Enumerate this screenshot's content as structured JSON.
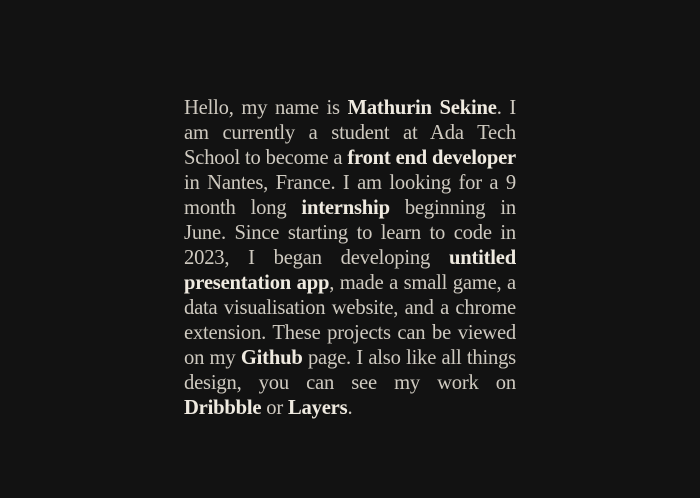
{
  "bio": {
    "p1": "Hello, my name is ",
    "name": "Mathurin Sekine",
    "p2": ". I am currently a student at Ada Tech School to become a ",
    "role": "front end developer",
    "p3": " in Nantes, France. I am looking for a 9 month long ",
    "internship": "internship",
    "p4": " beginning in June. Since starting to learn to code in 2023, I began developing ",
    "app": "untitled presentation app",
    "p5": ", made a small game, a data visualisation website, and a chrome extension. These projects can be viewed on my ",
    "github": "Github",
    "p6": " page. I also like all things design, you can see my work on ",
    "dribbble": "Dribbble",
    "p7": " or ",
    "layers": "Layers",
    "p8": "."
  },
  "colors": {
    "background": "#121212",
    "text": "#cfcac0",
    "highlight": "#efeae0"
  }
}
